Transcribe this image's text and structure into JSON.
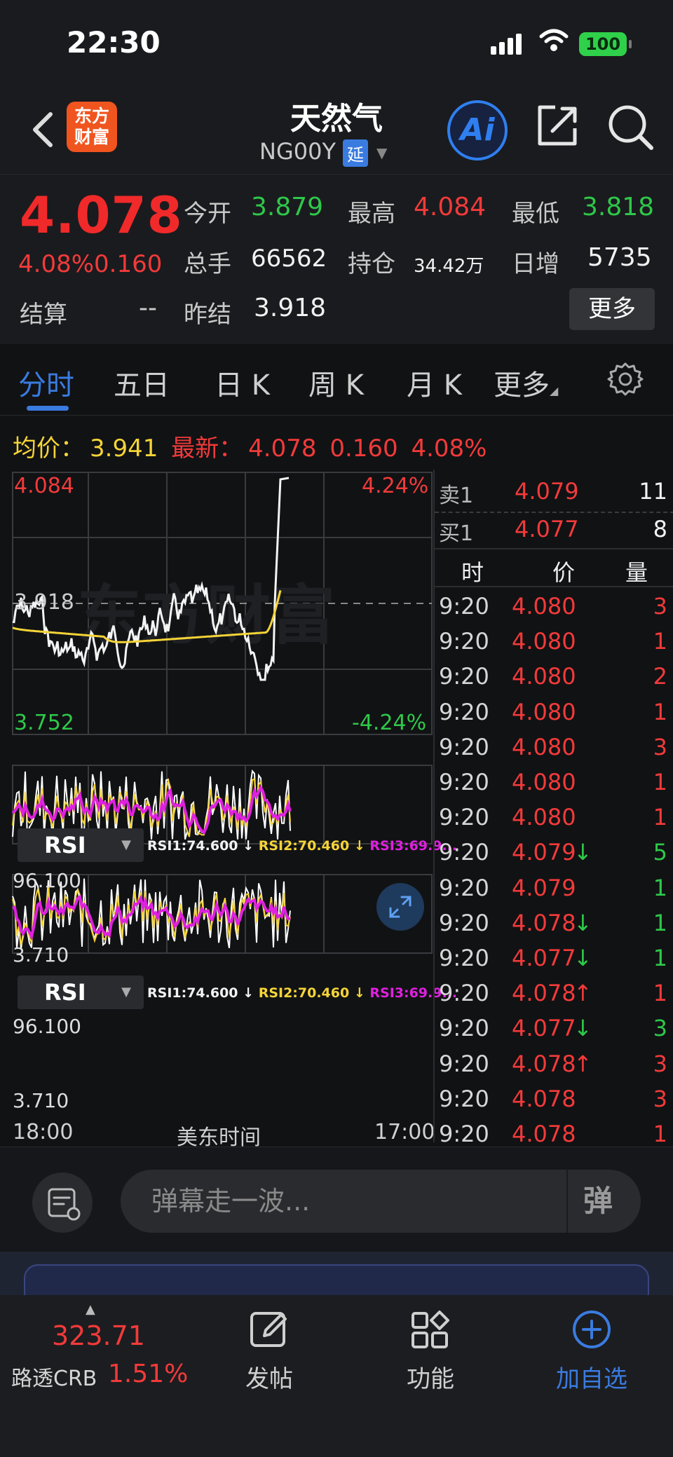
{
  "status_bar": {
    "time": "22:30",
    "battery": "100"
  },
  "header": {
    "back_icon": "chevron-left-icon",
    "logo_text_1": "东方",
    "logo_text_2": "财富",
    "title": "天然气",
    "code": "NG00Y",
    "delay_badge": "延",
    "ai_label": "Ai"
  },
  "quote": {
    "last": "4.078",
    "change_pct": "4.08%",
    "change": "0.160",
    "open_label": "今开",
    "open": "3.879",
    "high_label": "最高",
    "high": "4.084",
    "low_label": "最低",
    "low": "3.818",
    "volume_label": "总手",
    "volume": "66562",
    "oi_label": "持仓",
    "oi": "34.42万",
    "daily_inc_label": "日增",
    "daily_inc": "5735",
    "settle_label": "结算",
    "settle": "--",
    "prev_settle_label": "昨结",
    "prev_settle": "3.918",
    "more_label": "更多"
  },
  "tabs": [
    "分时",
    "五日",
    "日 K",
    "周 K",
    "月 K",
    "更多"
  ],
  "active_tab": "分时",
  "info_row": {
    "avg_label": "均价：",
    "avg": "3.941",
    "latest_label": "最新：",
    "latest": "4.078",
    "change": "0.160",
    "change_pct": "4.08%"
  },
  "chart": {
    "price_top": "4.084",
    "pct_top": "4.24%",
    "price_mid": "3.918",
    "price_bottom": "3.752",
    "pct_bottom": "-4.24%",
    "watermark": "东方财富",
    "rsi_panels": [
      {
        "selector": "RSI",
        "rsi1": "RSI1:74.600 ↓",
        "rsi2": "RSI2:70.460 ↓",
        "rsi3": "RSI3:69.9...",
        "top": "96.100",
        "bottom": "3.710"
      },
      {
        "selector": "RSI",
        "rsi1": "RSI1:74.600 ↓",
        "rsi2": "RSI2:70.460 ↓",
        "rsi3": "RSI3:69.9...",
        "top": "96.100",
        "bottom": "3.710"
      }
    ],
    "time_start": "18:00",
    "time_zone": "美东时间",
    "time_end": "17:00"
  },
  "order_book": {
    "ask": {
      "label": "卖1",
      "price": "4.079",
      "qty": "11"
    },
    "bid": {
      "label": "买1",
      "price": "4.077",
      "qty": "8"
    },
    "headers": [
      "时",
      "价",
      "量"
    ],
    "ticks": [
      {
        "time": "9:20",
        "price": "4.080",
        "arrow": "",
        "qty": "3",
        "color": "red"
      },
      {
        "time": "9:20",
        "price": "4.080",
        "arrow": "",
        "qty": "1",
        "color": "red"
      },
      {
        "time": "9:20",
        "price": "4.080",
        "arrow": "",
        "qty": "2",
        "color": "red"
      },
      {
        "time": "9:20",
        "price": "4.080",
        "arrow": "",
        "qty": "1",
        "color": "red"
      },
      {
        "time": "9:20",
        "price": "4.080",
        "arrow": "",
        "qty": "3",
        "color": "red"
      },
      {
        "time": "9:20",
        "price": "4.080",
        "arrow": "",
        "qty": "1",
        "color": "red"
      },
      {
        "time": "9:20",
        "price": "4.080",
        "arrow": "",
        "qty": "1",
        "color": "red"
      },
      {
        "time": "9:20",
        "price": "4.079",
        "arrow": "↓",
        "qty": "5",
        "color": "green"
      },
      {
        "time": "9:20",
        "price": "4.079",
        "arrow": "",
        "qty": "1",
        "color": "green"
      },
      {
        "time": "9:20",
        "price": "4.078",
        "arrow": "↓",
        "qty": "1",
        "color": "green"
      },
      {
        "time": "9:20",
        "price": "4.077",
        "arrow": "↓",
        "qty": "1",
        "color": "green"
      },
      {
        "time": "9:20",
        "price": "4.078",
        "arrow": "↑",
        "qty": "1",
        "color": "red"
      },
      {
        "time": "9:20",
        "price": "4.077",
        "arrow": "↓",
        "qty": "3",
        "color": "green"
      },
      {
        "time": "9:20",
        "price": "4.078",
        "arrow": "↑",
        "qty": "3",
        "color": "red"
      },
      {
        "time": "9:20",
        "price": "4.078",
        "arrow": "",
        "qty": "3",
        "color": "red"
      },
      {
        "time": "9:20",
        "price": "4.078",
        "arrow": "",
        "qty": "1",
        "color": "red"
      }
    ]
  },
  "danmaku": {
    "placeholder": "弹幕走一波...",
    "send_label": "弹"
  },
  "bottom_nav": {
    "crb_value": "323.71",
    "crb_name": "路透CRB",
    "crb_pct": "1.51%",
    "items": [
      "发帖",
      "功能",
      "加自选"
    ]
  },
  "colors": {
    "up": "#f23a3a",
    "down": "#2ec84a",
    "accent": "#3a7be0",
    "avg_line": "#f5d437",
    "rsi3": "#e020e0"
  }
}
